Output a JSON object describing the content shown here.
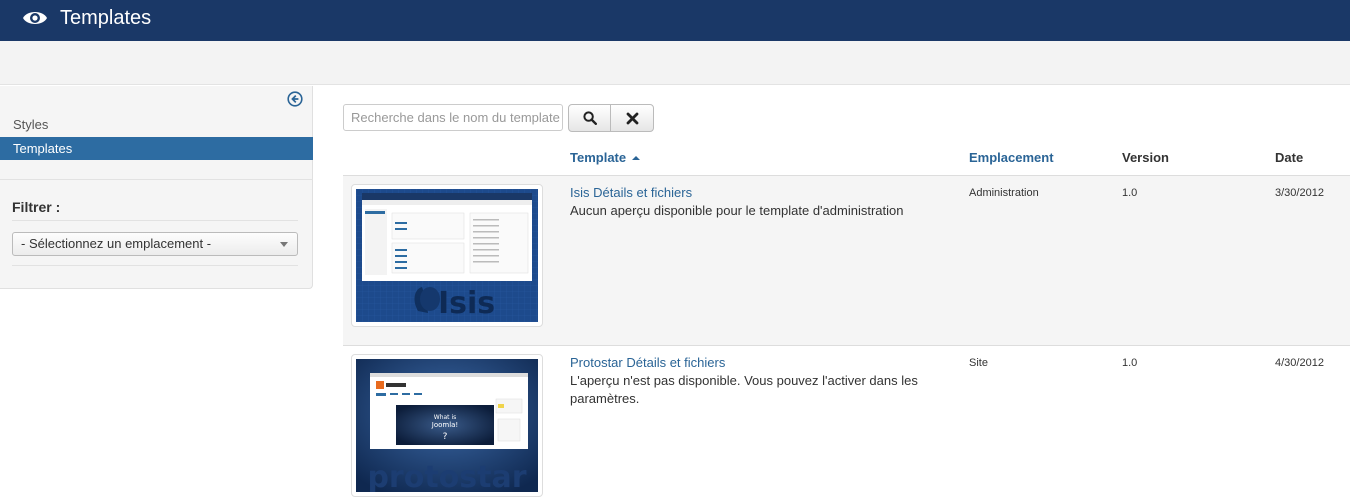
{
  "header": {
    "title": "Templates",
    "icon": "eye-icon"
  },
  "sidebar": {
    "items": [
      {
        "label": "Styles",
        "active": false
      },
      {
        "label": "Templates",
        "active": true
      }
    ],
    "filter_label": "Filtrer :",
    "location_select": {
      "selected": "- Sélectionnez un emplacement -"
    }
  },
  "search": {
    "placeholder": "Recherche dans le nom du template",
    "value": ""
  },
  "table": {
    "columns": {
      "template": "Template",
      "location": "Emplacement",
      "version": "Version",
      "date": "Date"
    },
    "sort": {
      "column": "template",
      "direction": "ascending"
    },
    "rows": [
      {
        "name": "Isis Détails et fichiers",
        "description": "Aucun aperçu disponible pour le template d'administration",
        "location": "Administration",
        "version": "1.0",
        "date": "3/30/2012",
        "thumb_text": "Isis"
      },
      {
        "name": "Protostar Détails et fichiers",
        "description": "L'aperçu n'est pas disponible. Vous pouvez l'activer dans les paramètres.",
        "location": "Site",
        "version": "1.0",
        "date": "4/30/2012",
        "thumb_text": "protostar"
      }
    ]
  },
  "colors": {
    "header_bg": "#1a3867",
    "active_item": "#2d6ca2",
    "link": "#2a6496"
  }
}
